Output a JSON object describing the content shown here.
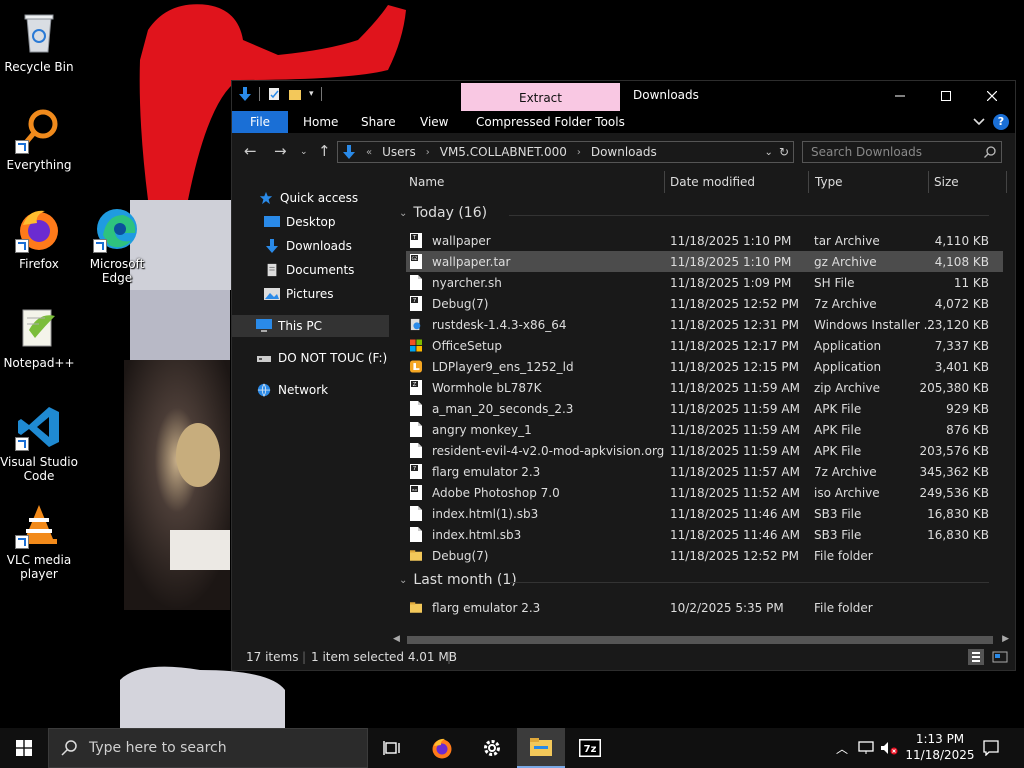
{
  "desktop": {
    "icons": [
      {
        "label": "Recycle Bin"
      },
      {
        "label": "Everything"
      },
      {
        "label": "Firefox"
      },
      {
        "label": "Microsoft Edge"
      },
      {
        "label": "Notepad++"
      },
      {
        "label": "Visual Studio Code"
      },
      {
        "label": "VLC media player"
      }
    ]
  },
  "window": {
    "title": "Downloads",
    "contextual_tab": "Extract",
    "ribbon_tabs": {
      "file": "File",
      "home": "Home",
      "share": "Share",
      "view": "View",
      "tools": "Compressed Folder Tools"
    },
    "address": {
      "overflow": "«",
      "crumbs": [
        "Users",
        "VM5.COLLABNET.000",
        "Downloads"
      ]
    },
    "search_placeholder": "Search Downloads",
    "nav": {
      "quick_access": "Quick access",
      "desktop": "Desktop",
      "downloads": "Downloads",
      "documents": "Documents",
      "pictures": "Pictures",
      "this_pc": "This PC",
      "drive": "DO NOT TOUC (F:)",
      "network": "Network"
    },
    "columns": {
      "name": "Name",
      "date": "Date modified",
      "type": "Type",
      "size": "Size"
    },
    "groups": [
      {
        "label": "Today (16)",
        "files": [
          {
            "name": "wallpaper",
            "date": "11/18/2025 1:10 PM",
            "type": "tar Archive",
            "size": "4,110 KB",
            "icon": "tar-archive-icon"
          },
          {
            "name": "wallpaper.tar",
            "date": "11/18/2025 1:10 PM",
            "type": "gz Archive",
            "size": "4,108 KB",
            "icon": "gz-archive-icon",
            "selected": true
          },
          {
            "name": "nyarcher.sh",
            "date": "11/18/2025 1:09 PM",
            "type": "SH File",
            "size": "11 KB",
            "icon": "file-icon"
          },
          {
            "name": "Debug(7)",
            "date": "11/18/2025 12:52 PM",
            "type": "7z Archive",
            "size": "4,072 KB",
            "icon": "7z-archive-icon"
          },
          {
            "name": "rustdesk-1.4.3-x86_64",
            "date": "11/18/2025 12:31 PM",
            "type": "Windows Installer ...",
            "size": "23,120 KB",
            "icon": "installer-icon"
          },
          {
            "name": "OfficeSetup",
            "date": "11/18/2025 12:17 PM",
            "type": "Application",
            "size": "7,337 KB",
            "icon": "office-icon"
          },
          {
            "name": "LDPlayer9_ens_1252_ld",
            "date": "11/18/2025 12:15 PM",
            "type": "Application",
            "size": "3,401 KB",
            "icon": "ldplayer-icon"
          },
          {
            "name": "Wormhole bL787K",
            "date": "11/18/2025 11:59 AM",
            "type": "zip Archive",
            "size": "205,380 KB",
            "icon": "zip-archive-icon"
          },
          {
            "name": "a_man_20_seconds_2.3",
            "date": "11/18/2025 11:59 AM",
            "type": "APK File",
            "size": "929 KB",
            "icon": "file-icon"
          },
          {
            "name": "angry monkey_1",
            "date": "11/18/2025 11:59 AM",
            "type": "APK File",
            "size": "876 KB",
            "icon": "file-icon"
          },
          {
            "name": "resident-evil-4-v2.0-mod-apkvision.org",
            "date": "11/18/2025 11:59 AM",
            "type": "APK File",
            "size": "203,576 KB",
            "icon": "file-icon"
          },
          {
            "name": "flarg emulator 2.3",
            "date": "11/18/2025 11:57 AM",
            "type": "7z Archive",
            "size": "345,362 KB",
            "icon": "7z-archive-icon"
          },
          {
            "name": "Adobe Photoshop 7.0",
            "date": "11/18/2025 11:52 AM",
            "type": "iso Archive",
            "size": "249,536 KB",
            "icon": "iso-archive-icon"
          },
          {
            "name": "index.html(1).sb3",
            "date": "11/18/2025 11:46 AM",
            "type": "SB3 File",
            "size": "16,830 KB",
            "icon": "file-icon"
          },
          {
            "name": "index.html.sb3",
            "date": "11/18/2025 11:46 AM",
            "type": "SB3 File",
            "size": "16,830 KB",
            "icon": "file-icon"
          },
          {
            "name": "Debug(7)",
            "date": "11/18/2025 12:52 PM",
            "type": "File folder",
            "size": "",
            "icon": "folder-icon"
          }
        ]
      },
      {
        "label": "Last month (1)",
        "files": [
          {
            "name": "flarg emulator 2.3",
            "date": "10/2/2025 5:35 PM",
            "type": "File folder",
            "size": "",
            "icon": "folder-icon"
          }
        ]
      }
    ],
    "status": {
      "count": "17 items",
      "selection": "1 item selected  4.01 MB"
    }
  },
  "taskbar": {
    "search_placeholder": "Type here to search",
    "time": "1:13 PM",
    "date": "11/18/2025"
  },
  "colors": {
    "accent": "#1a6fd6",
    "extract_tab": "#f9c8e3",
    "selected_row": "#4c4c4c",
    "folder": "#f3c85a"
  }
}
